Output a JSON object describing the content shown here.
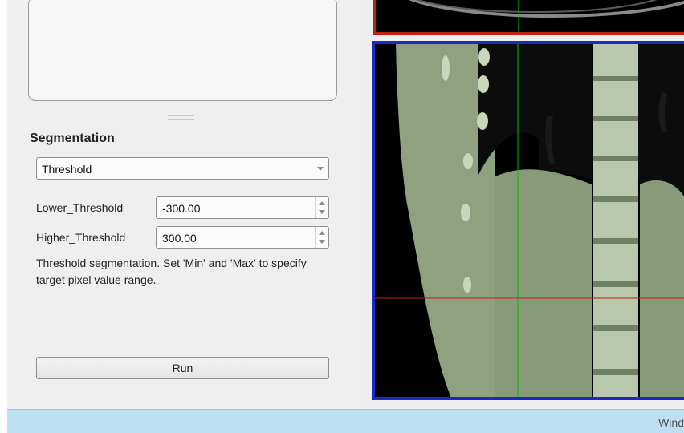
{
  "segmentation": {
    "title": "Segmentation",
    "method": "Threshold",
    "lower": {
      "label": "Lower_Threshold",
      "value": "-300.00"
    },
    "higher": {
      "label": "Higher_Threshold",
      "value": "300.00"
    },
    "description": "Threshold segmentation. Set 'Min' and 'Max' to specify target pixel value range.",
    "run_label": "Run"
  },
  "statusbar": {
    "text": "Wind"
  },
  "colors": {
    "axial_view_border": "#c02010",
    "coronal_view_border": "#1a2bc0",
    "crosshair_vertical": "#00c000",
    "crosshair_horizontal": "#c02010",
    "segmentation_overlay": "#9fb88f"
  }
}
